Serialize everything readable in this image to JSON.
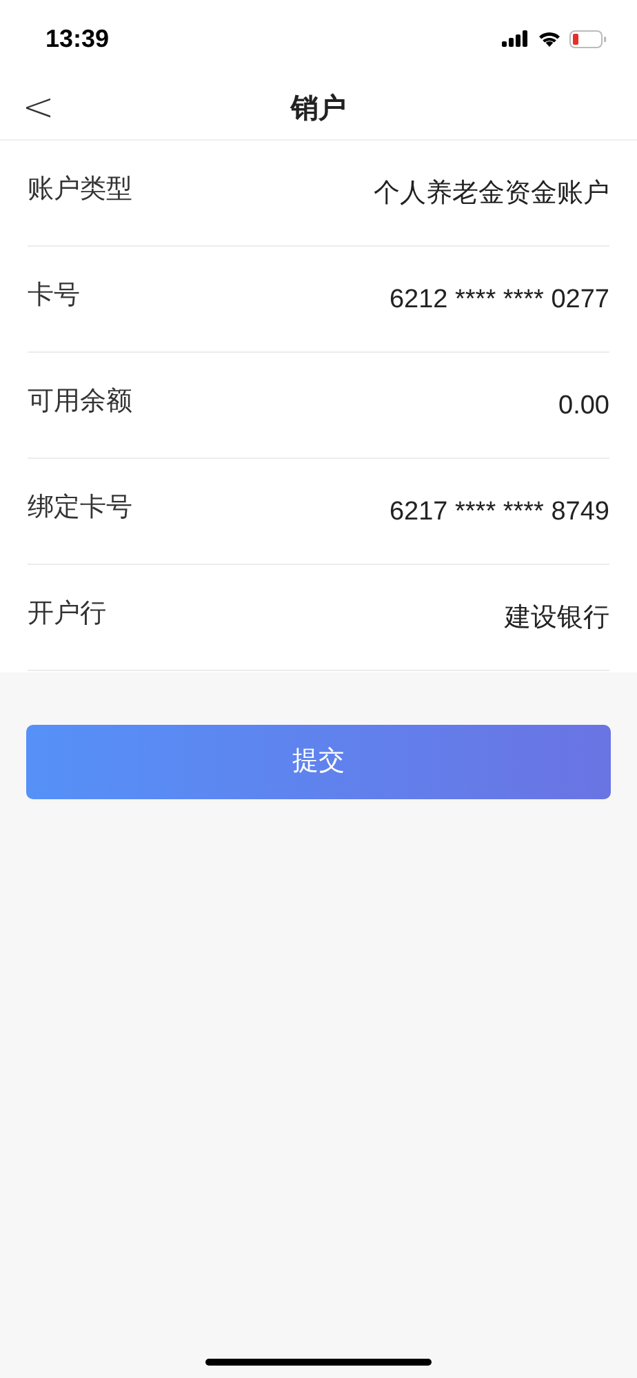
{
  "status_bar": {
    "time": "13:39"
  },
  "nav": {
    "back": "<",
    "title": "销户"
  },
  "fields": [
    {
      "label": "账户类型",
      "value": "个人养老金资金账户"
    },
    {
      "label": "卡号",
      "value": "6212 **** **** 0277"
    },
    {
      "label": "可用余额",
      "value": "0.00"
    },
    {
      "label": "绑定卡号",
      "value": "6217 **** **** 8749"
    },
    {
      "label": "开户行",
      "value": "建设银行"
    }
  ],
  "submit_button": "提交"
}
